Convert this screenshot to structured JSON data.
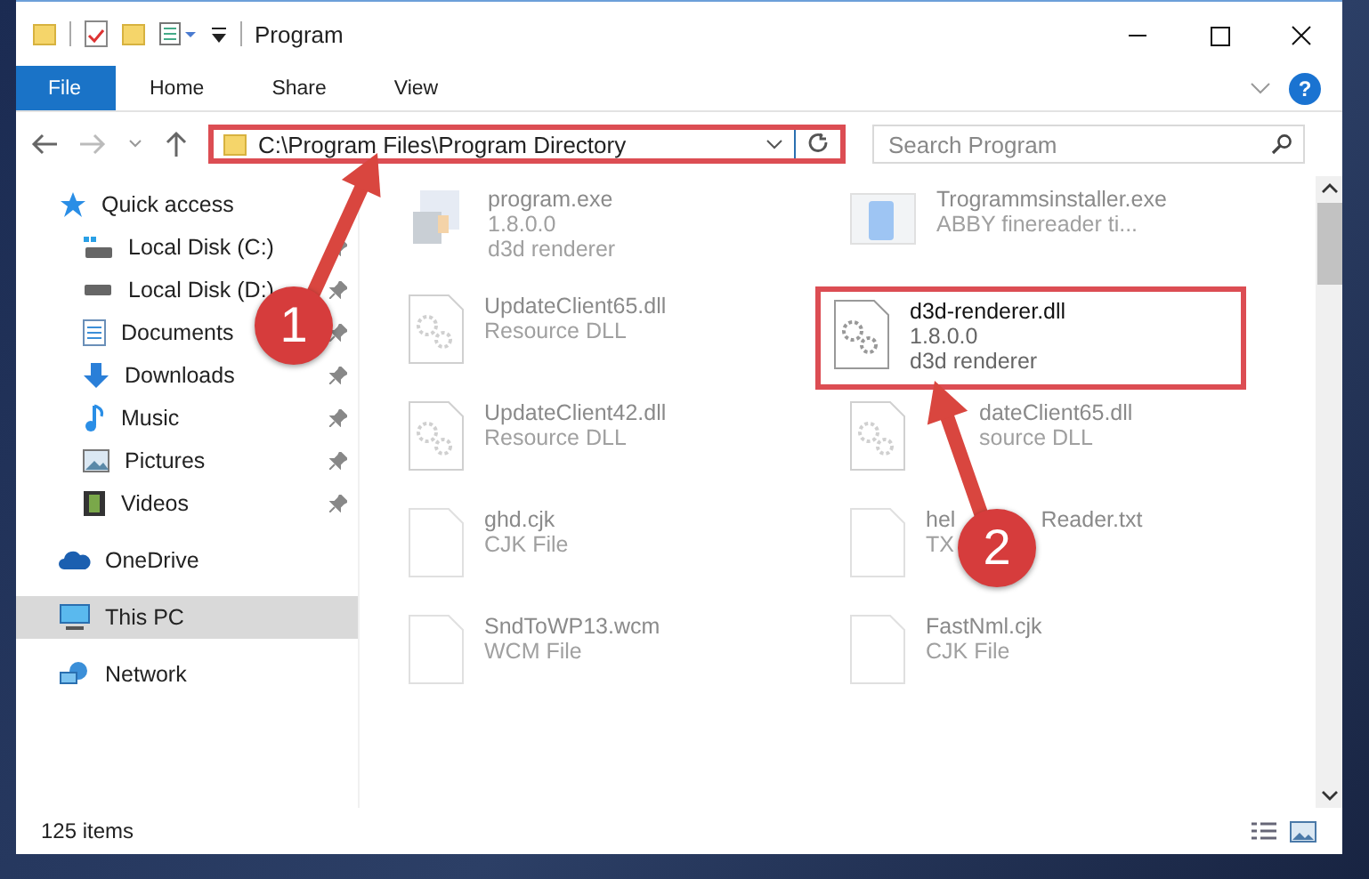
{
  "window": {
    "title": "Program"
  },
  "help": {
    "label": "?"
  },
  "ribbon_tabs": [
    {
      "label": "File",
      "selected": true
    },
    {
      "label": "Home",
      "selected": false
    },
    {
      "label": "Share",
      "selected": false
    },
    {
      "label": "View",
      "selected": false
    }
  ],
  "address_bar": {
    "path": "C:\\Program Files\\Program Directory",
    "highlighted": true
  },
  "search": {
    "placeholder": "Search Program"
  },
  "sidebar": {
    "items": [
      {
        "label": "Quick access",
        "kind": "star",
        "selected": false,
        "children": [
          {
            "label": "Local Disk (C:)",
            "kind": "drive-c",
            "pinned": true,
            "selected": false
          },
          {
            "label": "Local Disk (D:)",
            "kind": "drive",
            "pinned": true,
            "selected": false
          },
          {
            "label": "Documents",
            "kind": "document",
            "pinned": true,
            "selected": false
          },
          {
            "label": "Downloads",
            "kind": "download",
            "pinned": true,
            "selected": false
          },
          {
            "label": "Music",
            "kind": "music",
            "pinned": true,
            "selected": false
          },
          {
            "label": "Pictures",
            "kind": "picture",
            "pinned": true,
            "selected": false
          },
          {
            "label": "Videos",
            "kind": "video",
            "pinned": true,
            "selected": false
          }
        ]
      },
      {
        "label": "OneDrive",
        "kind": "cloud",
        "selected": false
      },
      {
        "label": "This PC",
        "kind": "pc",
        "selected": true
      },
      {
        "label": "Network",
        "kind": "network",
        "selected": false
      }
    ]
  },
  "files": [
    {
      "name": "program.exe",
      "lines": [
        "1.8.0.0",
        "d3d renderer"
      ],
      "kind": "exe",
      "faded": true
    },
    {
      "name": "Trogrammsinstaller.exe",
      "lines": [
        "ABBY finereader ti..."
      ],
      "kind": "app",
      "faded": true
    },
    {
      "name": "UpdateClient65.dll",
      "lines": [
        "Resource DLL"
      ],
      "kind": "dll",
      "faded": true
    },
    {
      "name": "d3d-renderer.dll",
      "lines": [
        "1.8.0.0",
        "d3d renderer"
      ],
      "kind": "dll",
      "faded": false,
      "highlighted": true
    },
    {
      "name": "UpdateClient42.dll",
      "lines": [
        "Resource DLL"
      ],
      "kind": "dll",
      "faded": true
    },
    {
      "name": "dateClient65.dll",
      "lines": [
        "source DLL"
      ],
      "kind": "dll",
      "faded": true,
      "covered": true
    },
    {
      "name": "ghd.cjk",
      "lines": [
        "CJK File"
      ],
      "kind": "file",
      "faded": true
    },
    {
      "name": "hel",
      "name_tail": "Reader.txt",
      "lines": [
        "TX"
      ],
      "kind": "file",
      "faded": true
    },
    {
      "name": "SndToWP13.wcm",
      "lines": [
        "WCM File"
      ],
      "kind": "file",
      "faded": true
    },
    {
      "name": "FastNml.cjk",
      "lines": [
        "CJK File"
      ],
      "kind": "file",
      "faded": true
    }
  ],
  "status_bar": {
    "item_count": "125 items"
  },
  "annotations": [
    {
      "label": "1"
    },
    {
      "label": "2"
    }
  ]
}
